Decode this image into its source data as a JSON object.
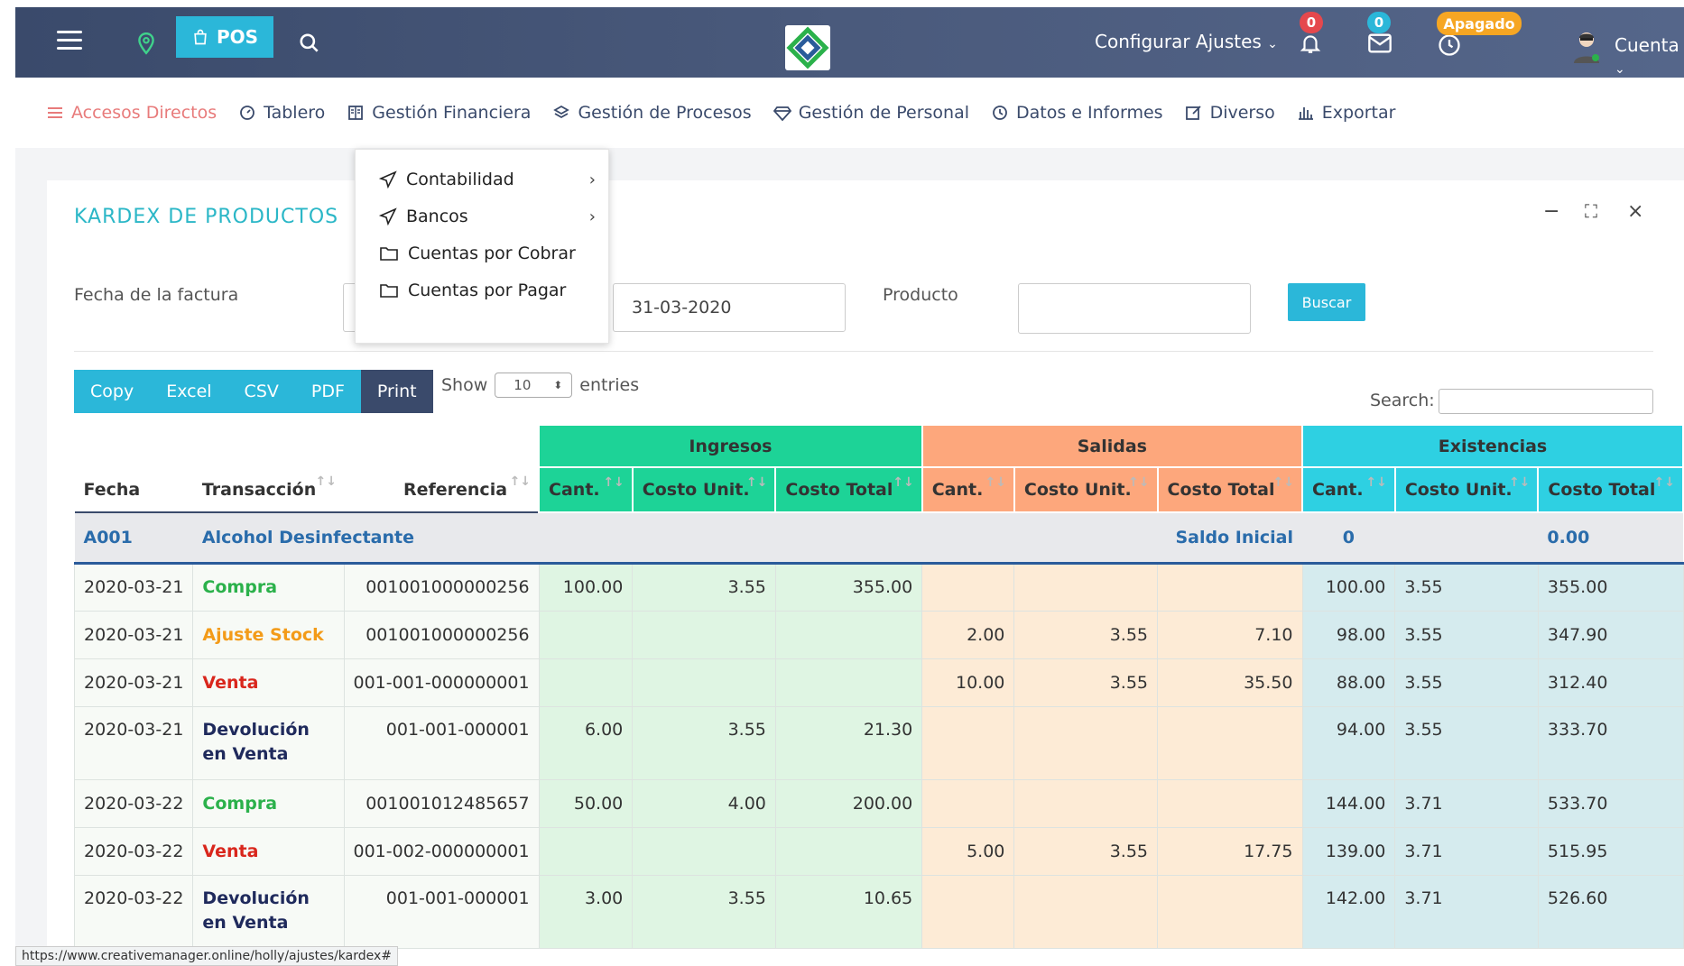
{
  "topbar": {
    "pos_label": "POS",
    "config_label": "Configurar Ajustes",
    "notif_count": "0",
    "mail_count": "0",
    "status_label": "Apagado",
    "account_label": "Cuenta"
  },
  "nav": {
    "items": [
      {
        "label": "Accesos Directos",
        "icon": "menu-icon"
      },
      {
        "label": "Tablero",
        "icon": "gauge-icon"
      },
      {
        "label": "Gestión Financiera",
        "icon": "book-icon"
      },
      {
        "label": "Gestión de Procesos",
        "icon": "layers-icon"
      },
      {
        "label": "Gestión de Personal",
        "icon": "diamond-icon"
      },
      {
        "label": "Datos e Informes",
        "icon": "history-icon"
      },
      {
        "label": "Diverso",
        "icon": "edit-icon"
      },
      {
        "label": "Exportar",
        "icon": "bar-chart-icon"
      }
    ]
  },
  "dropdown": {
    "items": [
      "Contabilidad",
      "Bancos",
      "Cuentas por Cobrar",
      "Cuentas por Pagar"
    ]
  },
  "card": {
    "title": "KARDEX DE PRODUCTOS",
    "fecha_label": "Fecha de la factura",
    "fecha_hasta": "31-03-2020",
    "producto_label": "Producto",
    "buscar_label": "Buscar"
  },
  "export": {
    "copy": "Copy",
    "excel": "Excel",
    "csv": "CSV",
    "pdf": "PDF",
    "print": "Print"
  },
  "length": {
    "show": "Show",
    "value": "10",
    "entries": "entries"
  },
  "search_label": "Search:",
  "table": {
    "groups": {
      "ingresos": "Ingresos",
      "salidas": "Salidas",
      "existencias": "Existencias"
    },
    "headers": [
      "Fecha",
      "Transacción",
      "Referencia",
      "Cant.",
      "Costo Unit.",
      "Costo Total",
      "Cant.",
      "Costo Unit.",
      "Costo Total",
      "Cant.",
      "Costo Unit.",
      "Costo Total"
    ],
    "product": {
      "code": "A001",
      "name": "Alcohol Desinfectante",
      "saldo_label": "Saldo Inicial",
      "cant": "0",
      "total": "0.00"
    },
    "rows": [
      {
        "fecha": "2020-03-21",
        "trans": "Compra",
        "type": "compra",
        "ref": "001001000000256",
        "ic": "100.00",
        "iu": "3.55",
        "it": "355.00",
        "sc": "",
        "su": "",
        "st": "",
        "ec": "100.00",
        "eu": "3.55",
        "et": "355.00"
      },
      {
        "fecha": "2020-03-21",
        "trans": "Ajuste Stock",
        "type": "ajuste",
        "ref": "001001000000256",
        "ic": "",
        "iu": "",
        "it": "",
        "sc": "2.00",
        "su": "3.55",
        "st": "7.10",
        "ec": "98.00",
        "eu": "3.55",
        "et": "347.90"
      },
      {
        "fecha": "2020-03-21",
        "trans": "Venta",
        "type": "venta",
        "ref": "001-001-000000001",
        "ic": "",
        "iu": "",
        "it": "",
        "sc": "10.00",
        "su": "3.55",
        "st": "35.50",
        "ec": "88.00",
        "eu": "3.55",
        "et": "312.40"
      },
      {
        "fecha": "2020-03-21",
        "trans": "Devolución en Venta",
        "type": "dev",
        "ref": "001-001-000001",
        "ic": "6.00",
        "iu": "3.55",
        "it": "21.30",
        "sc": "",
        "su": "",
        "st": "",
        "ec": "94.00",
        "eu": "3.55",
        "et": "333.70"
      },
      {
        "fecha": "2020-03-22",
        "trans": "Compra",
        "type": "compra",
        "ref": "001001012485657",
        "ic": "50.00",
        "iu": "4.00",
        "it": "200.00",
        "sc": "",
        "su": "",
        "st": "",
        "ec": "144.00",
        "eu": "3.71",
        "et": "533.70"
      },
      {
        "fecha": "2020-03-22",
        "trans": "Venta",
        "type": "venta",
        "ref": "001-002-000000001",
        "ic": "",
        "iu": "",
        "it": "",
        "sc": "5.00",
        "su": "3.55",
        "st": "17.75",
        "ec": "139.00",
        "eu": "3.71",
        "et": "515.95"
      },
      {
        "fecha": "2020-03-22",
        "trans": "Devolución en Venta",
        "type": "dev",
        "ref": "001-001-000001",
        "ic": "3.00",
        "iu": "3.55",
        "it": "10.65",
        "sc": "",
        "su": "",
        "st": "",
        "ec": "142.00",
        "eu": "3.71",
        "et": "526.60"
      }
    ]
  },
  "status_url": "https://www.creativemanager.online/holly/ajustes/kardex#",
  "colors": {
    "accent": "#2bb7d9",
    "topbar": "#3a4a6b",
    "ingresos": "#1dd397",
    "salidas": "#fda77c",
    "existencias": "#2ed0e2"
  }
}
